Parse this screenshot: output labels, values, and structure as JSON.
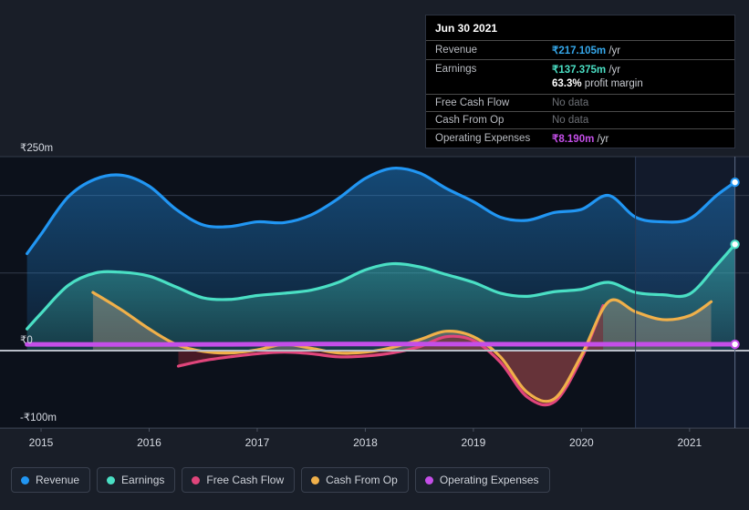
{
  "tooltip": {
    "title": "Jun 30 2021",
    "rows": [
      {
        "key": "Revenue",
        "value": "₹217.105m",
        "unit": "/yr",
        "color": "#35a7ea",
        "nodata": false
      },
      {
        "key": "Earnings",
        "value": "₹137.375m",
        "unit": "/yr",
        "color": "#4adfc4",
        "nodata": false
      },
      {
        "key": "Free Cash Flow",
        "value": "No data",
        "unit": "",
        "color": "#6d7076",
        "nodata": true
      },
      {
        "key": "Cash From Op",
        "value": "No data",
        "unit": "",
        "color": "#6d7076",
        "nodata": true
      },
      {
        "key": "Operating Expenses",
        "value": "₹8.190m",
        "unit": "/yr",
        "color": "#c44ee8",
        "nodata": false
      }
    ],
    "profit_margin_value": "63.3%",
    "profit_margin_label": "profit margin"
  },
  "legend": {
    "items": [
      {
        "label": "Revenue",
        "color": "#2196f3"
      },
      {
        "label": "Earnings",
        "color": "#4adfc4"
      },
      {
        "label": "Free Cash Flow",
        "color": "#e0457b"
      },
      {
        "label": "Cash From Op",
        "color": "#f0b04a"
      },
      {
        "label": "Operating Expenses",
        "color": "#c44ee8"
      }
    ]
  },
  "chart_data": {
    "type": "area",
    "title": "",
    "xlabel": "",
    "ylabel": "",
    "currency": "₹",
    "xlim": [
      2014.62,
      2021.55
    ],
    "ylim": [
      -120,
      265
    ],
    "grid": true,
    "legend_position": "bottom",
    "x_tick_labels": [
      "2015",
      "2016",
      "2017",
      "2018",
      "2019",
      "2020",
      "2021"
    ],
    "x_ticks": [
      2015,
      2016,
      2017,
      2018,
      2019,
      2020,
      2021
    ],
    "y_tick_labels": [
      "₹250m",
      "₹0",
      "-₹100m"
    ],
    "y_ticks": [
      250,
      0,
      -100
    ],
    "y_gridlines": [
      250,
      200,
      100,
      0,
      -100
    ],
    "forecast_start_x": 2020.5,
    "highlight_x": 2021.42,
    "series": [
      {
        "name": "Revenue",
        "color": "#2196f3",
        "x": [
          2014.87,
          2015.0,
          2015.25,
          2015.5,
          2015.75,
          2016.0,
          2016.25,
          2016.5,
          2016.75,
          2017.0,
          2017.25,
          2017.5,
          2017.75,
          2018.0,
          2018.25,
          2018.5,
          2018.75,
          2019.0,
          2019.25,
          2019.5,
          2019.75,
          2020.0,
          2020.25,
          2020.5,
          2020.75,
          2021.0,
          2021.25,
          2021.42
        ],
        "values": [
          125,
          150,
          198,
          221,
          226,
          212,
          182,
          162,
          160,
          166,
          165,
          175,
          196,
          222,
          235,
          229,
          209,
          192,
          172,
          168,
          178,
          182,
          200,
          172,
          166,
          170,
          200,
          217
        ]
      },
      {
        "name": "Earnings",
        "color": "#4adfc4",
        "x": [
          2014.87,
          2015.0,
          2015.25,
          2015.5,
          2015.75,
          2016.0,
          2016.25,
          2016.5,
          2016.75,
          2017.0,
          2017.25,
          2017.5,
          2017.75,
          2018.0,
          2018.25,
          2018.5,
          2018.75,
          2019.0,
          2019.25,
          2019.5,
          2019.75,
          2020.0,
          2020.25,
          2020.5,
          2020.75,
          2021.0,
          2021.25,
          2021.42
        ],
        "values": [
          28,
          48,
          84,
          100,
          101,
          96,
          82,
          68,
          66,
          71,
          74,
          78,
          88,
          104,
          112,
          108,
          98,
          88,
          74,
          70,
          76,
          79,
          88,
          75,
          72,
          73,
          110,
          137
        ]
      },
      {
        "name": "Free Cash Flow",
        "color": "#e0457b",
        "x": [
          2016.27,
          2016.5,
          2016.75,
          2017.0,
          2017.25,
          2017.5,
          2017.75,
          2018.0,
          2018.25,
          2018.5,
          2018.75,
          2019.0,
          2019.25,
          2019.5,
          2019.75,
          2020.0,
          2020.2
        ],
        "values": [
          -20,
          -13,
          -8,
          -4,
          -2,
          -4,
          -8,
          -7,
          -3,
          5,
          18,
          13,
          -15,
          -60,
          -66,
          -10,
          58
        ]
      },
      {
        "name": "Cash From Op",
        "color": "#f0b04a",
        "x": [
          2015.48,
          2015.75,
          2016.0,
          2016.25,
          2016.5,
          2016.75,
          2017.0,
          2017.25,
          2017.5,
          2017.75,
          2018.0,
          2018.25,
          2018.5,
          2018.75,
          2019.0,
          2019.25,
          2019.5,
          2019.75,
          2020.0,
          2020.25,
          2020.5,
          2020.75,
          2021.0,
          2021.2
        ],
        "values": [
          75,
          52,
          28,
          8,
          -1,
          -3,
          1,
          8,
          3,
          -3,
          -2,
          4,
          14,
          25,
          18,
          -8,
          -54,
          -62,
          -6,
          63,
          50,
          40,
          45,
          63
        ]
      },
      {
        "name": "Operating Expenses",
        "color": "#c44ee8",
        "x": [
          2014.87,
          2016.7,
          2017.5,
          2018.5,
          2019.5,
          2020.5,
          2021.42
        ],
        "values": [
          8,
          8,
          8.5,
          8.5,
          8.2,
          8.2,
          8.19
        ]
      }
    ]
  }
}
